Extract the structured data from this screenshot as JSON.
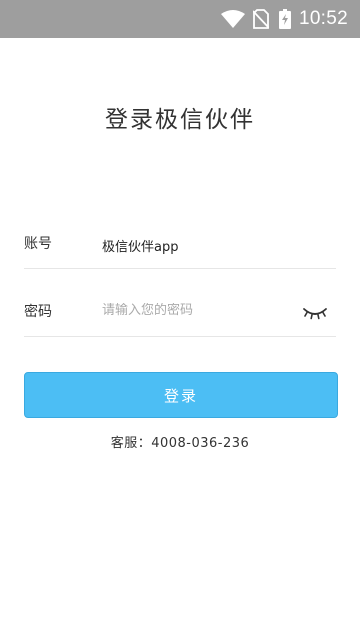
{
  "status_bar": {
    "time": "10:52",
    "icons": [
      "wifi-icon",
      "no-sim-icon",
      "battery-charging-icon"
    ]
  },
  "title": "登录极信伙伴",
  "form": {
    "account": {
      "label": "账号",
      "value": "极信伙伴app"
    },
    "password": {
      "label": "密码",
      "placeholder": "请输入您的密码",
      "toggle_icon": "eye-closed-icon"
    }
  },
  "login_button": "登录",
  "customer_service": "客服：4008-036-236",
  "colors": {
    "status_bar": "#9e9e9e",
    "button": "#4cbef4",
    "text": "#333333",
    "placeholder": "#aaaaaa",
    "divider": "#e6e6e6"
  }
}
